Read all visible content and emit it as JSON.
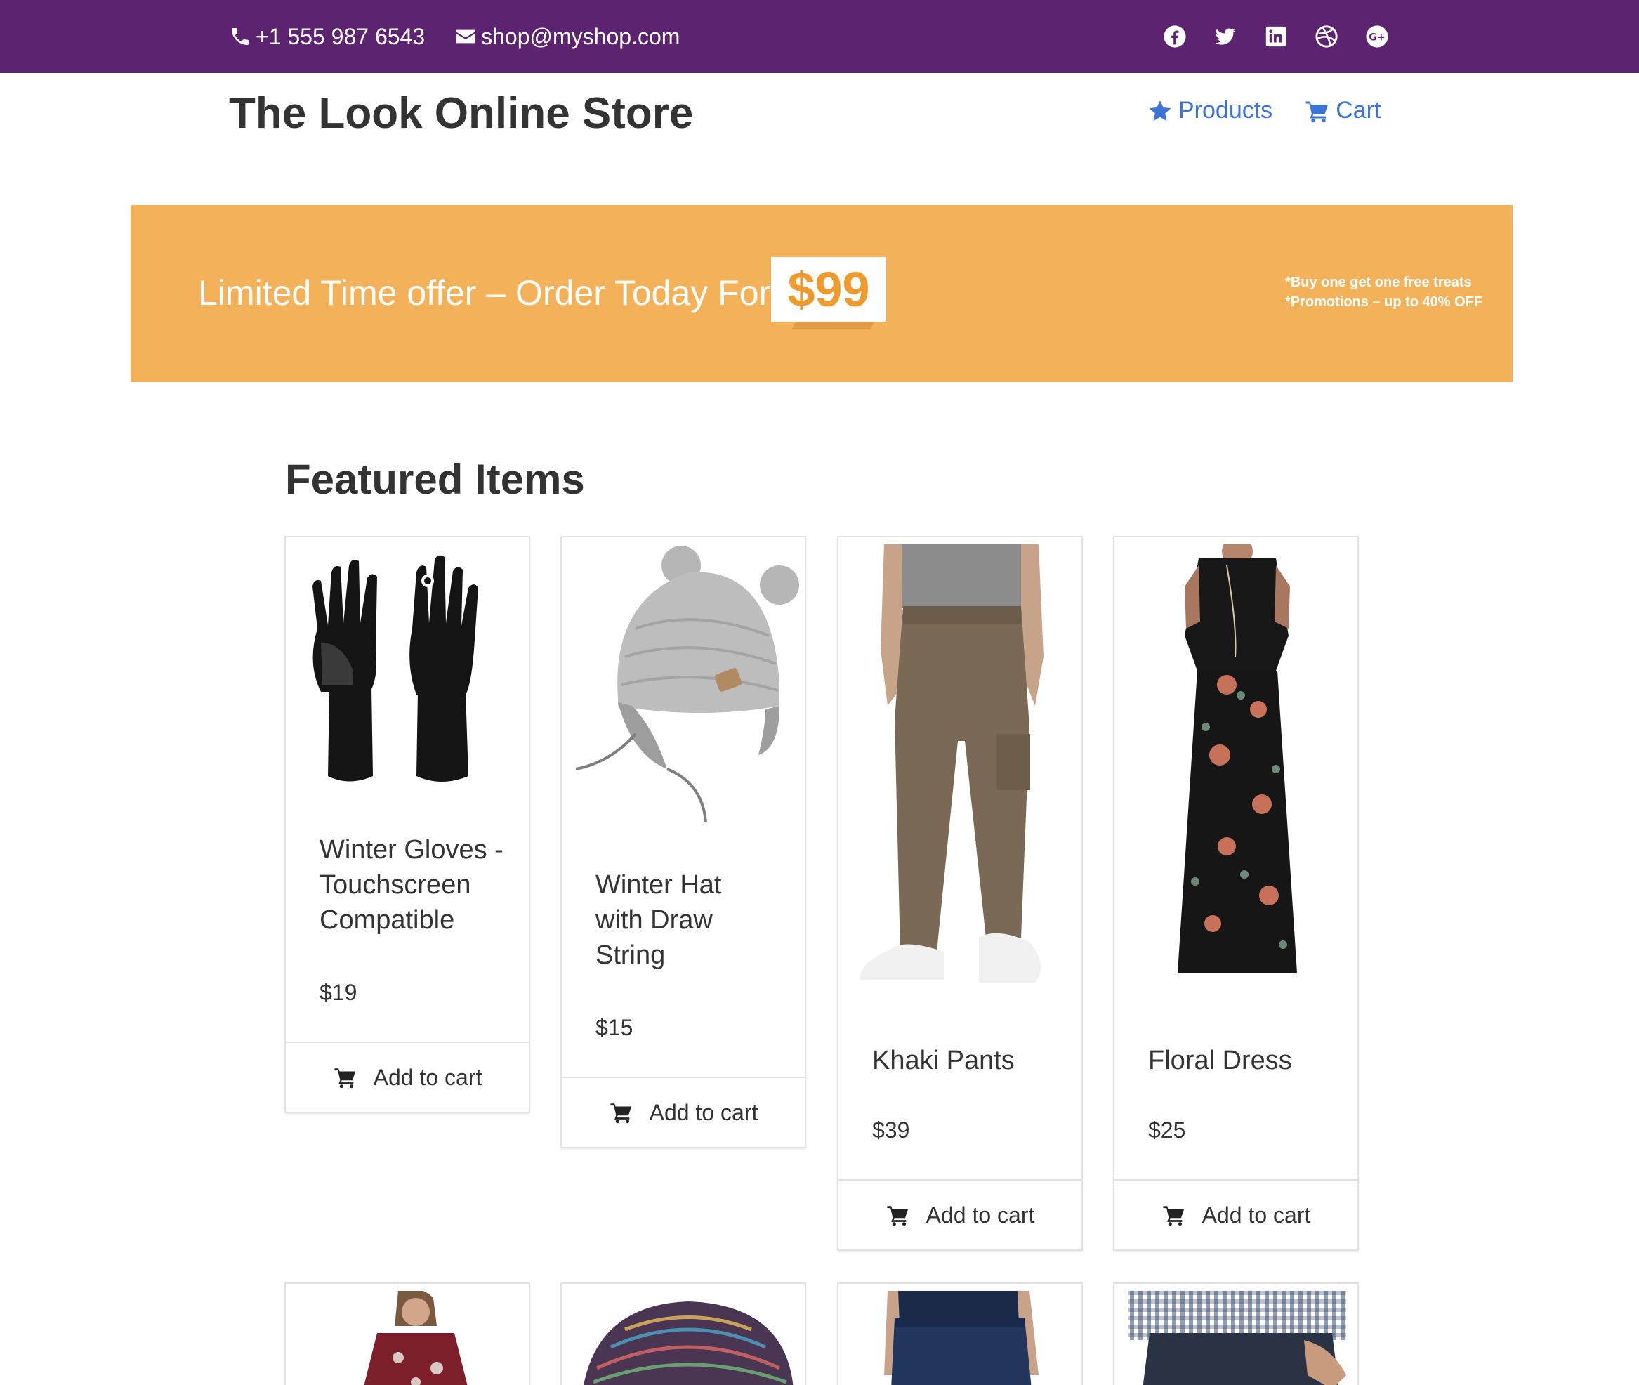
{
  "topbar": {
    "phone": "+1 555 987 6543",
    "email": "shop@myshop.com",
    "social": [
      "facebook-icon",
      "twitter-icon",
      "linkedin-icon",
      "dribbble-icon",
      "google-plus-icon"
    ]
  },
  "header": {
    "brand": "The Look Online Store",
    "nav": {
      "products": "Products",
      "cart": "Cart"
    }
  },
  "banner": {
    "offer": "Limited Time offer – Order Today For",
    "price": "$99",
    "promo_line1": "*Buy one get one free treats",
    "promo_line2": "*Promotions – up to 40% OFF"
  },
  "featured": {
    "title": "Featured Items",
    "items": [
      {
        "name": "Winter Gloves - Touchscreen Compatible",
        "price": "$19",
        "button": "Add to cart"
      },
      {
        "name": "Winter Hat with Draw String",
        "price": "$15",
        "button": "Add to cart"
      },
      {
        "name": "Khaki Pants",
        "price": "$39",
        "button": "Add to cart"
      },
      {
        "name": "Floral Dress",
        "price": "$25",
        "button": "Add to cart"
      }
    ]
  },
  "colors": {
    "topbar": "#5c2470",
    "nav_link": "#3b74d6",
    "banner": "#f3b259",
    "banner_price": "#ee9a2c"
  }
}
